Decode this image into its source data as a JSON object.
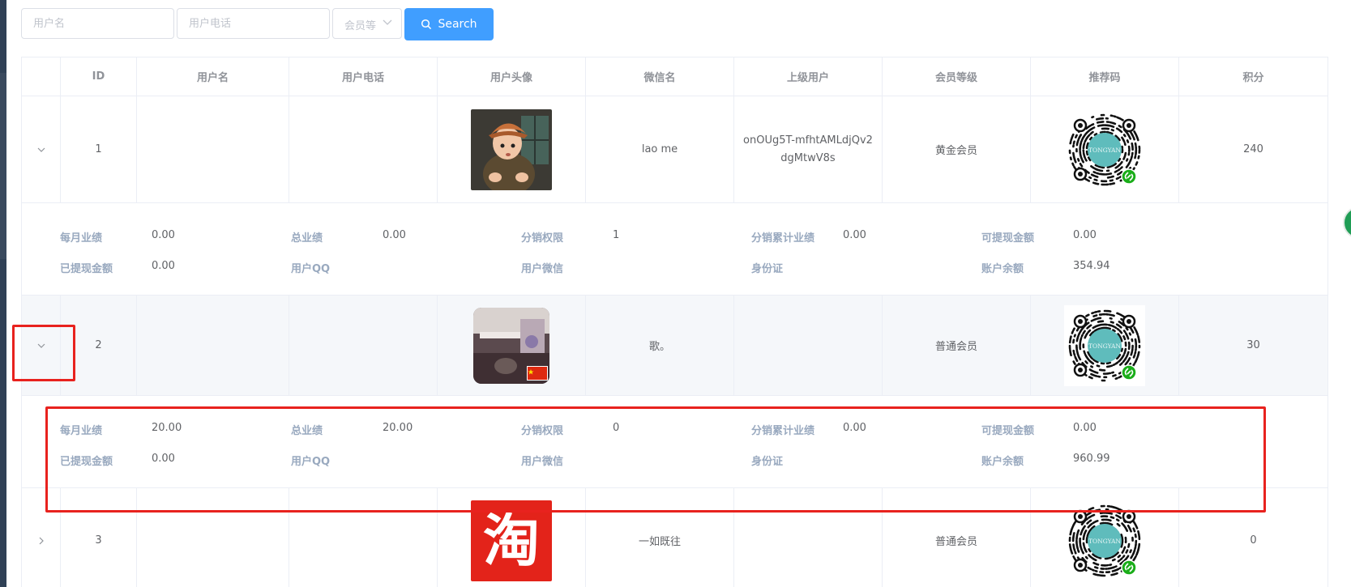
{
  "filters": {
    "username_placeholder": "用户名",
    "phone_placeholder": "用户电话",
    "member_level_placeholder": "会员等级",
    "member_level_visible": "会员等",
    "search_label": "Search"
  },
  "table": {
    "headers": [
      "ID",
      "用户名",
      "用户电话",
      "用户头像",
      "微信名",
      "上级用户",
      "会员等级",
      "推荐码",
      "积分"
    ],
    "rows": [
      {
        "id": "1",
        "username": "",
        "phone": "",
        "avatar": "avatar-boy-cartoon",
        "wechat_name": "lao me",
        "parent_user": "onOUg5T-mfhtAMLdjQv2dgMtwV8s",
        "member_level": "黄金会员",
        "qr_text": "TONGYAN",
        "points": "240",
        "expanded": true
      },
      {
        "id": "2",
        "username": "",
        "phone": "",
        "avatar": "avatar-desk-room",
        "wechat_name": "歌。",
        "parent_user": "",
        "member_level": "普通会员",
        "qr_text": "TONGYAN",
        "points": "30",
        "expanded": true
      },
      {
        "id": "3",
        "username": "",
        "phone": "",
        "avatar": "avatar-taobao",
        "avatar_text": "淘",
        "wechat_name": "一如既往",
        "parent_user": "",
        "member_level": "普通会员",
        "qr_text": "TONGYAN",
        "points": "0",
        "expanded": false
      }
    ],
    "details": [
      {
        "line1": [
          {
            "label": "每月业绩",
            "value": "0.00"
          },
          {
            "label": "总业绩",
            "value": "0.00"
          },
          {
            "label": "分销权限",
            "value": "1"
          },
          {
            "label": "分销累计业绩",
            "value": "0.00"
          },
          {
            "label": "可提现金额",
            "value": "0.00"
          }
        ],
        "line2": [
          {
            "label": "已提现金额",
            "value": "0.00"
          },
          {
            "label": "用户QQ",
            "value": ""
          },
          {
            "label": "用户微信",
            "value": ""
          },
          {
            "label": "身份证",
            "value": ""
          },
          {
            "label": "账户余额",
            "value": "354.94"
          }
        ]
      },
      {
        "line1": [
          {
            "label": "每月业绩",
            "value": "20.00"
          },
          {
            "label": "总业绩",
            "value": "20.00"
          },
          {
            "label": "分销权限",
            "value": "0"
          },
          {
            "label": "分销累计业绩",
            "value": "0.00"
          },
          {
            "label": "可提现金额",
            "value": "0.00"
          }
        ],
        "line2": [
          {
            "label": "已提现金额",
            "value": "0.00"
          },
          {
            "label": "用户QQ",
            "value": ""
          },
          {
            "label": "用户微信",
            "value": ""
          },
          {
            "label": "身份证",
            "value": ""
          },
          {
            "label": "账户余额",
            "value": "960.99"
          }
        ]
      }
    ]
  },
  "colors": {
    "primary": "#409eff",
    "highlight": "#e8221e",
    "detail_label": "#99a9bf",
    "qr_center": "#5fbcbc",
    "miniprogram_badge": "#1aad19"
  }
}
